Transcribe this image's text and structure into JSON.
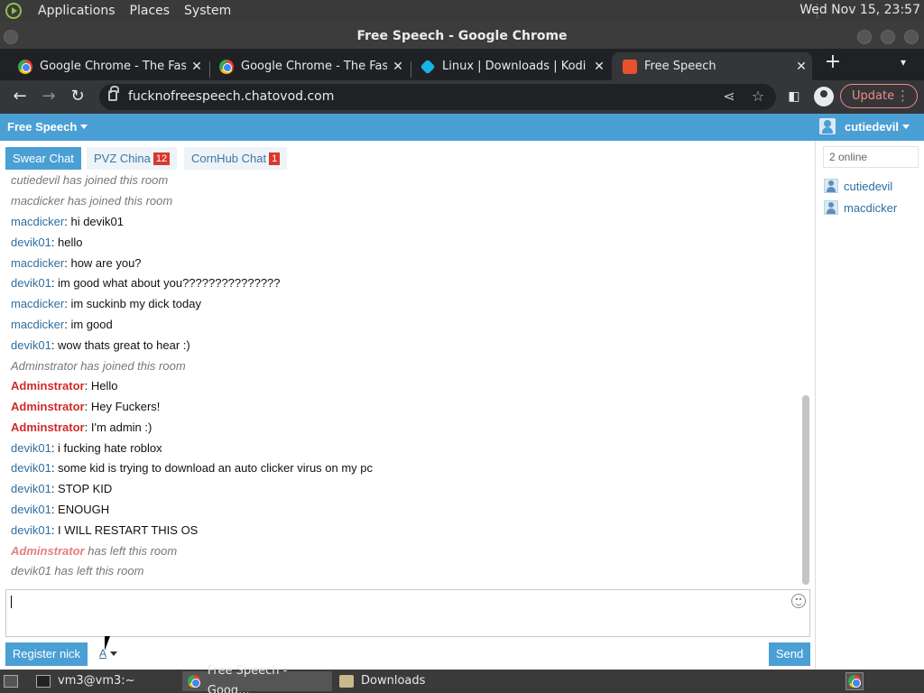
{
  "system_panel": {
    "menus": [
      "Applications",
      "Places",
      "System"
    ],
    "clock": "Wed Nov 15, 23:57"
  },
  "window": {
    "title": "Free Speech - Google Chrome"
  },
  "tabs": [
    {
      "title": "Google Chrome - The Fast & Secure Web Browser",
      "favicon": "chrome-icon"
    },
    {
      "title": "Google Chrome - The Fast & Secure Web Browser",
      "favicon": "chrome-icon"
    },
    {
      "title": "Linux | Downloads | Kodi",
      "favicon": "kodi-icon"
    },
    {
      "title": "Free Speech",
      "favicon": "free-speech-icon",
      "active": true
    }
  ],
  "toolbar": {
    "url": "fucknofreespeech.chatovod.com",
    "update_label": "Update"
  },
  "page": {
    "brand": "Free Speech",
    "username": "cutiedevil",
    "rooms": [
      {
        "label": "Swear Chat",
        "badge": "",
        "active": true
      },
      {
        "label": "PVZ China",
        "badge": "12"
      },
      {
        "label": "CornHub Chat",
        "badge": "1"
      }
    ],
    "messages": [
      {
        "type": "system",
        "text": "cutiedevil has joined this room"
      },
      {
        "type": "system",
        "text": "macdicker has joined this room"
      },
      {
        "type": "chat",
        "nick": "macdicker",
        "text": ": hi devik01"
      },
      {
        "type": "chat",
        "nick": "devik01",
        "text": ": hello"
      },
      {
        "type": "chat",
        "nick": "macdicker",
        "text": ": how are you?"
      },
      {
        "type": "chat",
        "nick": "devik01",
        "text": ": im good what about you???????????????"
      },
      {
        "type": "chat",
        "nick": "macdicker",
        "text": ": im suckinb my dick today"
      },
      {
        "type": "chat",
        "nick": "macdicker",
        "text": ": im good"
      },
      {
        "type": "chat",
        "nick": "devik01",
        "text": ": wow thats great to hear :)"
      },
      {
        "type": "system",
        "text": "Adminstrator has joined this room"
      },
      {
        "type": "admin",
        "nick": "Adminstrator",
        "text": ": Hello"
      },
      {
        "type": "admin",
        "nick": "Adminstrator",
        "text": ": Hey Fuckers!"
      },
      {
        "type": "admin",
        "nick": "Adminstrator",
        "text": ": I'm admin :)"
      },
      {
        "type": "chat",
        "nick": "devik01",
        "text": ": i fucking hate roblox"
      },
      {
        "type": "chat",
        "nick": "devik01",
        "text": ": some kid is trying to download an auto clicker virus on my pc"
      },
      {
        "type": "chat",
        "nick": "devik01",
        "text": ": STOP KID"
      },
      {
        "type": "chat",
        "nick": "devik01",
        "text": ": ENOUGH"
      },
      {
        "type": "chat",
        "nick": "devik01",
        "text": ": I WILL RESTART THIS OS"
      },
      {
        "type": "admin-left",
        "nick": "Adminstrator",
        "text": " has left this room"
      },
      {
        "type": "system",
        "text": "devik01 has left this room"
      }
    ],
    "register_label": "Register nick",
    "font_label": "A",
    "send_label": "Send",
    "sidebar": {
      "online_count": "2 online",
      "users": [
        "cutiedevil",
        "macdicker"
      ]
    }
  },
  "taskbar": {
    "tasks": [
      {
        "label": "vm3@vm3:~",
        "icon": "terminal-icon"
      },
      {
        "label": "Free Speech - Goog...",
        "icon": "chrome-icon",
        "active": true
      },
      {
        "label": "Downloads",
        "icon": "folder-icon"
      }
    ]
  }
}
